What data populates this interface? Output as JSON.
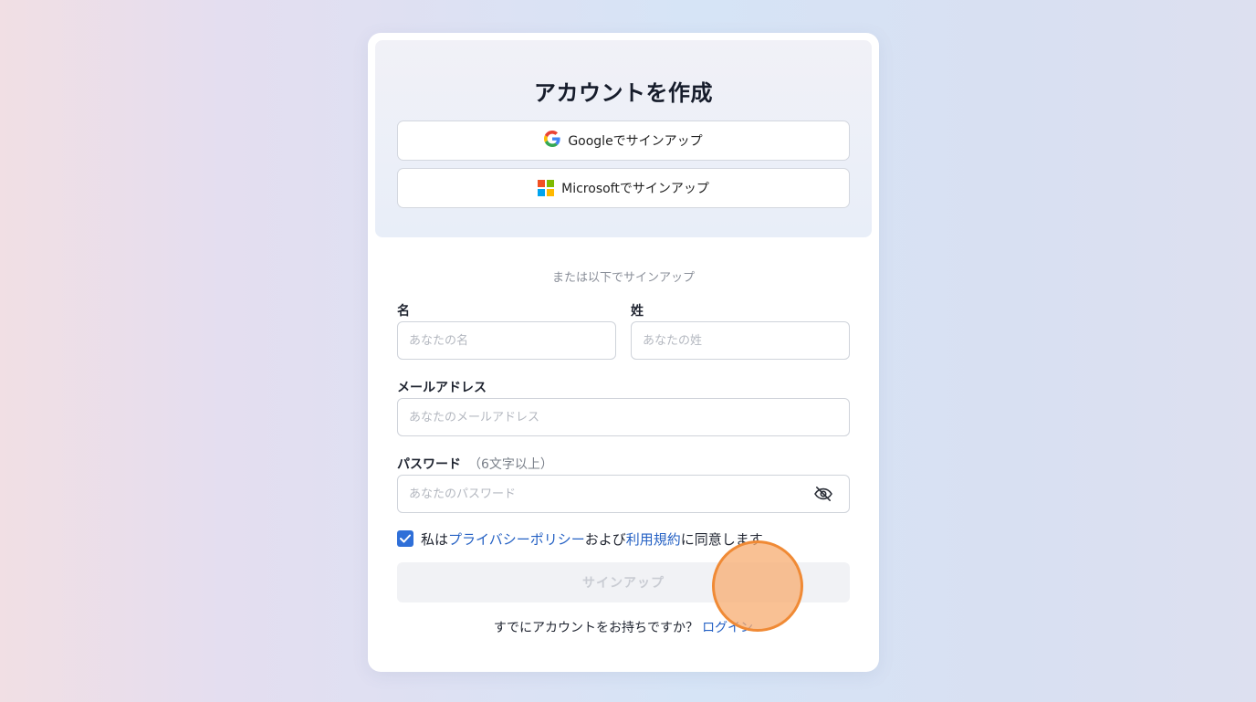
{
  "card": {
    "title": "アカウントを作成",
    "google_button": "Googleでサインアップ",
    "microsoft_button": "Microsoftでサインアップ",
    "divider": "または以下でサインアップ"
  },
  "form": {
    "first_name_label": "名",
    "first_name_placeholder": "あなたの名",
    "last_name_label": "姓",
    "last_name_placeholder": "あなたの姓",
    "email_label": "メールアドレス",
    "email_placeholder": "あなたのメールアドレス",
    "password_label": "パスワード",
    "password_hint": "（6文字以上）",
    "password_placeholder": "あなたのパスワード",
    "agree_prefix": "私は",
    "privacy_link": "プライバシーポリシー",
    "agree_mid": "および",
    "terms_link": "利用規約",
    "agree_suffix": "に同意します",
    "agree_checked": true,
    "submit_label": "サインアップ",
    "login_prompt": "すでにアカウントをお持ちですか？",
    "login_link": "ログイン"
  },
  "colors": {
    "accent": "#2561c4",
    "checkbox": "#2f6fd8",
    "cursor_fill": "#f7ac70",
    "cursor_stroke": "#f08a35"
  },
  "icons": {
    "google": "google-logo-icon",
    "microsoft": "microsoft-logo-icon",
    "password_toggle": "eye-off-icon",
    "checkbox_mark": "check-icon"
  }
}
